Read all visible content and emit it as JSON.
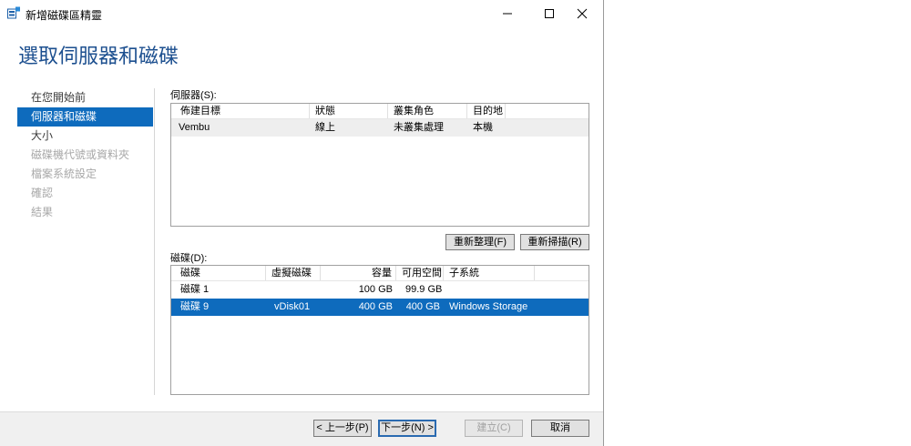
{
  "window": {
    "title": "新增磁碟區精靈",
    "minimize_icon": "minimize-icon",
    "maximize_icon": "maximize-icon",
    "close_icon": "close-icon"
  },
  "page_title": "選取伺服器和磁碟",
  "nav": {
    "items": [
      {
        "label": "在您開始前",
        "state": "normal"
      },
      {
        "label": "伺服器和磁碟",
        "state": "active"
      },
      {
        "label": "大小",
        "state": "normal"
      },
      {
        "label": "磁碟機代號或資料夾",
        "state": "disabled"
      },
      {
        "label": "檔案系統設定",
        "state": "disabled"
      },
      {
        "label": "確認",
        "state": "disabled"
      },
      {
        "label": "結果",
        "state": "disabled"
      }
    ]
  },
  "servers": {
    "label": "伺服器(S):",
    "columns": [
      "佈建目標",
      "狀態",
      "叢集角色",
      "目的地"
    ],
    "rows": [
      {
        "target": "Vembu",
        "status": "線上",
        "cluster_role": "未叢集處理",
        "destination": "本機"
      }
    ],
    "refresh_button": "重新整理(F)",
    "rescan_button": "重新掃描(R)"
  },
  "disks": {
    "label": "磁碟(D):",
    "columns": [
      "磁碟",
      "虛擬磁碟",
      "容量",
      "可用空間",
      "子系統"
    ],
    "rows": [
      {
        "disk": "磁碟 1",
        "virtual_disk": "",
        "capacity": "100 GB",
        "free_space": "99.9 GB",
        "subsystem": "",
        "selected": false
      },
      {
        "disk": "磁碟 9",
        "virtual_disk": "vDisk01",
        "capacity": "400 GB",
        "free_space": "400 GB",
        "subsystem": "Windows Storage",
        "selected": true
      }
    ]
  },
  "footer": {
    "previous": "< 上一步(P)",
    "next": "下一步(N) >",
    "create": "建立(C)",
    "cancel": "取消"
  },
  "colors": {
    "accent": "#0e6bbd",
    "heading": "#1c4f8f",
    "disabled_text": "#a8a8a8"
  }
}
